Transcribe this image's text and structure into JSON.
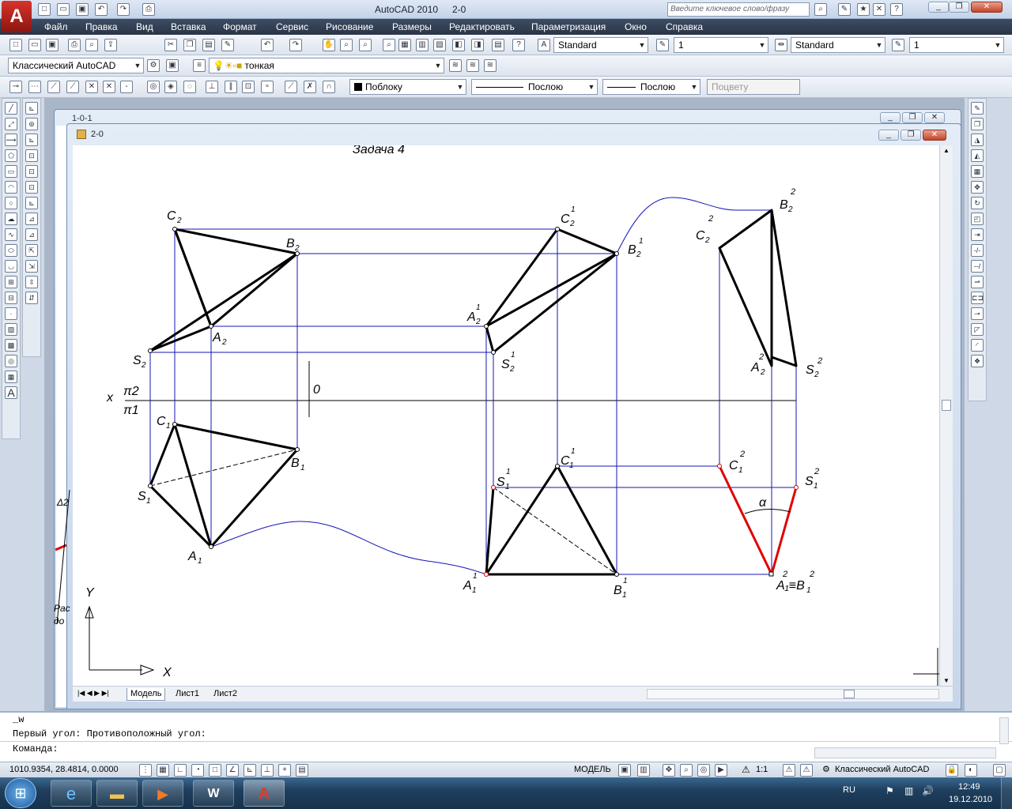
{
  "app": {
    "title": "AutoCAD 2010",
    "doc": "2-0",
    "search_placeholder": "Введите ключевое слово/фразу"
  },
  "menu": [
    "Файл",
    "Правка",
    "Вид",
    "Вставка",
    "Формат",
    "Сервис",
    "Рисование",
    "Размеры",
    "Редактировать",
    "Параметризация",
    "Окно",
    "Справка"
  ],
  "toolbar": {
    "text_style": "Standard",
    "text_height": "1",
    "dim_style": "Standard",
    "dim_scale": "1",
    "workspace": "Классический AutoCAD",
    "layer": "тонкая",
    "color": "Поблоку",
    "linetype": "Послою",
    "lineweight": "Послою",
    "plotstyle": "Поцвету"
  },
  "windows": {
    "back_title": "1-0-1",
    "front_title": "2-0"
  },
  "drawing": {
    "heading": "Задача 4",
    "axis_x": "x",
    "pi2": "π2",
    "pi1": "π1",
    "origin": "0",
    "alpha": "α",
    "ucs_x": "X",
    "ucs_y": "Y",
    "labels": {
      "C2": "C",
      "B2": "B",
      "A2": "A",
      "S2": "S",
      "C1": "C",
      "B1": "B",
      "S1": "S",
      "A1": "A",
      "C21": "C",
      "B21": "B",
      "A21": "A",
      "S21": "S",
      "C11": "C",
      "S11": "S",
      "A11": "A",
      "B11": "B",
      "B22": "B",
      "C22": "C",
      "A22": "A",
      "S22": "S",
      "C12": "C",
      "S12": "S",
      "A1B1": "A₁≡B"
    },
    "side_marks": [
      "Δ2",
      "Рас",
      "до"
    ]
  },
  "tabs": [
    "Модель",
    "Лист1",
    "Лист2"
  ],
  "command": {
    "line1": "_w",
    "line2": "Первый угол: Противоположный угол:",
    "prompt": "Команда:"
  },
  "status": {
    "coords": "1010.9354, 28.4814, 0.0000",
    "model": "МОДЕЛЬ",
    "scale": "1:1",
    "workspace": "Классический AutoCAD"
  },
  "taskbar": {
    "lang": "RU",
    "time": "12:49",
    "date": "19.12.2010"
  }
}
